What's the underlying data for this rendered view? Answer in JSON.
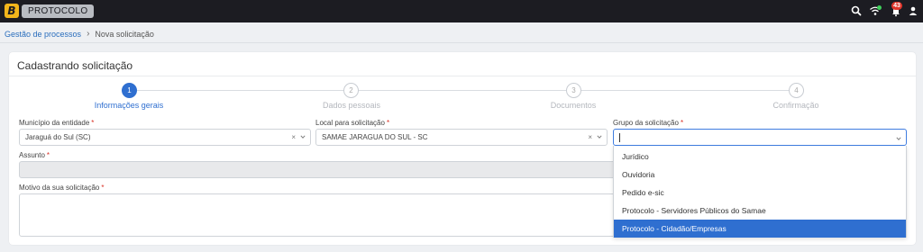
{
  "app": {
    "logo_letter": "B",
    "name": "PROTOCOLO",
    "notification_count": "43"
  },
  "topbar_icons": [
    "search-icon",
    "wifi-icon",
    "bell-icon",
    "user-icon"
  ],
  "breadcrumb": {
    "parent": "Gestão de processos",
    "separator": "›",
    "current": "Nova solicitação"
  },
  "page": {
    "title": "Cadastrando solicitação"
  },
  "steps": [
    {
      "number": "1",
      "label": "Informações gerais",
      "active": true
    },
    {
      "number": "2",
      "label": "Dados pessoais",
      "active": false
    },
    {
      "number": "3",
      "label": "Documentos",
      "active": false
    },
    {
      "number": "4",
      "label": "Confirmação",
      "active": false
    }
  ],
  "form": {
    "municipio": {
      "label": "Município da entidade",
      "value": "Jaraguá do Sul (SC)"
    },
    "local": {
      "label": "Local para solicitação",
      "value": "SAMAE JARAGUA DO SUL - SC"
    },
    "grupo": {
      "label": "Grupo da solicitação",
      "value": ""
    },
    "assunto": {
      "label": "Assunto",
      "value": ""
    },
    "motivo": {
      "label": "Motivo da sua solicitação",
      "value": ""
    },
    "required_mark": "*",
    "clear_glyph": "×"
  },
  "dropdown": {
    "options": [
      "Jurídico",
      "Ouvidoria",
      "Pedido e-sic",
      "Protocolo - Servidores Públicos do Samae",
      "Protocolo - Cidadão/Empresas"
    ],
    "highlighted": "Protocolo - Cidadão/Empresas"
  },
  "colors": {
    "accent": "#2f6fd0",
    "topbar": "#1c1c22",
    "badge": "#e0352b",
    "logo": "#f2b51b"
  }
}
